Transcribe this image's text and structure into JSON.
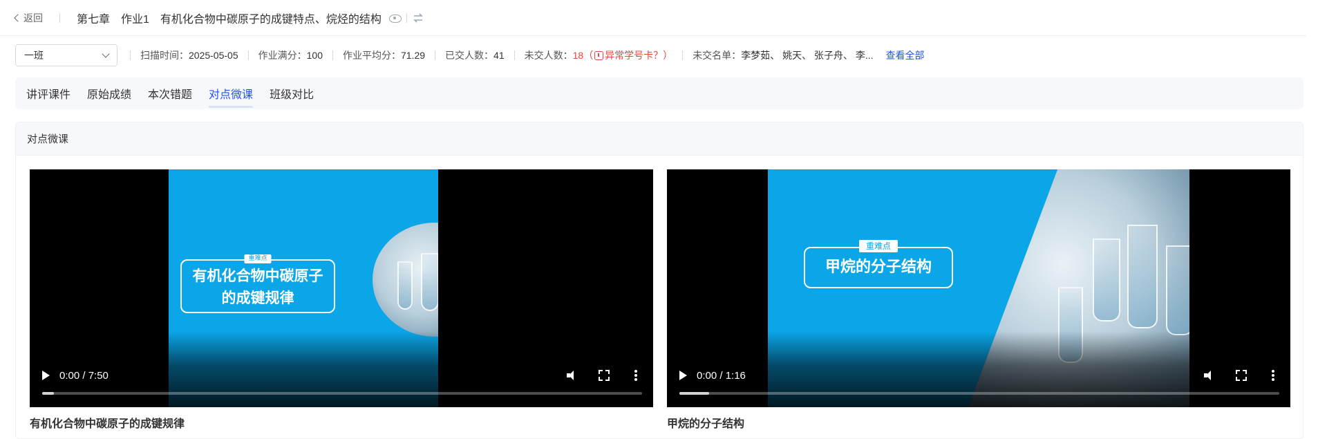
{
  "header": {
    "back_label": "返回",
    "chapter": "第七章",
    "assignment": "作业1",
    "title": "有机化合物中碳原子的成键特点、烷烃的结构"
  },
  "filters": {
    "class_select": "一班",
    "scan_time_label": "扫描时间：",
    "scan_time": "2025-05-05",
    "full_score_label": "作业满分：",
    "full_score": "100",
    "avg_score_label": "作业平均分：",
    "avg_score": "71.29",
    "submitted_label": "已交人数：",
    "submitted": "41",
    "unsubmitted_label": "未交人数：",
    "unsubmitted": "18",
    "abnormal_open": "（",
    "abnormal_label": "异常学号卡？",
    "abnormal_close": "）",
    "unsubmitted_list_label": "未交名单：",
    "unsubmitted_list": "李梦茹、 姚天、 张子舟、 李...",
    "view_all": "查看全部"
  },
  "tabs": [
    {
      "label": "讲评课件",
      "active": false
    },
    {
      "label": "原始成绩",
      "active": false
    },
    {
      "label": "本次错题",
      "active": false
    },
    {
      "label": "对点微课",
      "active": true
    },
    {
      "label": "班级对比",
      "active": false
    }
  ],
  "panel": {
    "title": "对点微课",
    "videos": [
      {
        "badge": "重难点",
        "slide_title_line1": "有机化合物中碳原子",
        "slide_title_line2": "的成键规律",
        "time": "0:00 / 7:50",
        "progress": 0.02,
        "caption": "有机化合物中碳原子的成键规律"
      },
      {
        "badge": "重难点",
        "slide_title_line1": "甲烷的分子结构",
        "time": "0:00 / 1:16",
        "progress": 0.05,
        "caption": "甲烷的分子结构"
      }
    ]
  },
  "colors": {
    "accent": "#2154e8",
    "alert": "#e8463a",
    "slide_blue": "#0aa6e8"
  },
  "icons": {
    "back": "chevron-left-icon",
    "preview": "eye-icon",
    "switch": "swap-icon",
    "dropdown": "chevron-down-icon",
    "warning": "warning-icon",
    "play": "play-icon",
    "volume": "volume-icon",
    "fullscreen": "fullscreen-icon",
    "more": "more-vertical-icon"
  }
}
